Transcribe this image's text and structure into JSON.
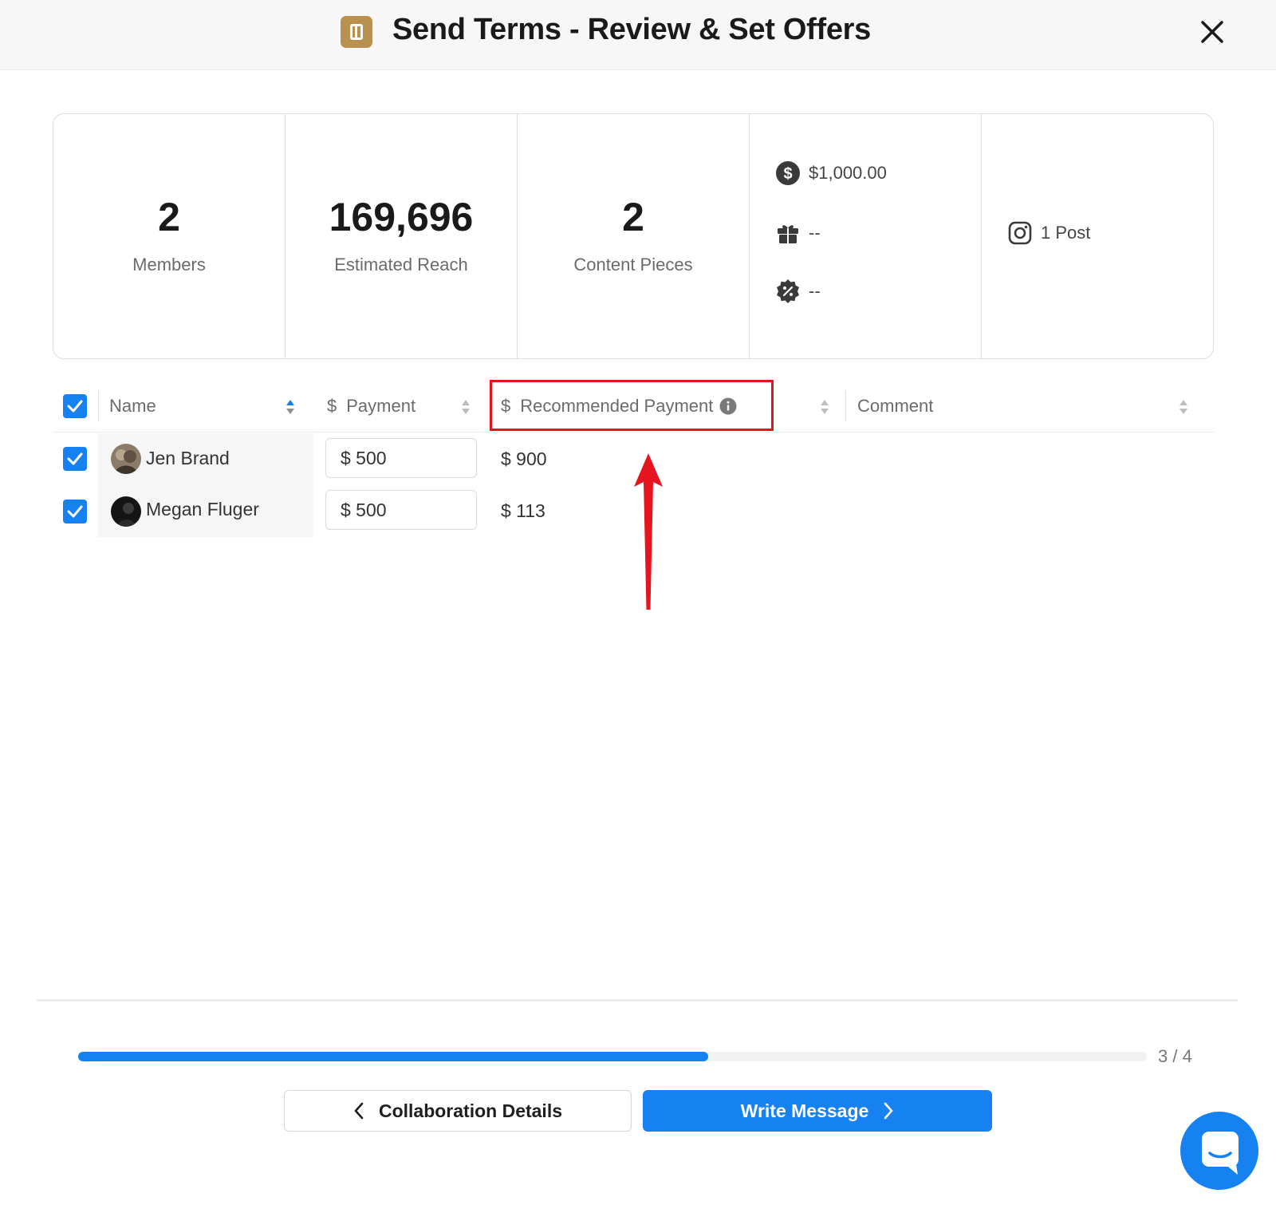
{
  "header": {
    "title": "Send Terms - Review & Set Offers",
    "app_icon": "document-icon",
    "close_icon": "close-icon"
  },
  "stats": [
    {
      "value": "2",
      "label": "Members"
    },
    {
      "value": "169,696",
      "label": "Estimated Reach"
    },
    {
      "value": "2",
      "label": "Content Pieces"
    }
  ],
  "terms": {
    "payment": {
      "icon": "dollar-circle-icon",
      "value": "$1,000.00"
    },
    "product": {
      "icon": "gift-icon",
      "value": "--"
    },
    "discount": {
      "icon": "percent-badge-icon",
      "value": "--"
    }
  },
  "deliverables": {
    "icon": "instagram-icon",
    "text": "1 Post"
  },
  "table": {
    "headers": {
      "name": "Name",
      "payment_symbol": "$",
      "payment": "Payment",
      "recommended_symbol": "$",
      "recommended": "Recommended Payment",
      "comment": "Comment"
    },
    "rows": [
      {
        "name": "Jen Brand",
        "payment_value": "$ 500",
        "recommended": "$ 900"
      },
      {
        "name": "Megan Fluger",
        "payment_value": "$ 500",
        "recommended": "$ 113"
      }
    ]
  },
  "progress": {
    "text": "3 / 4",
    "fraction": 0.5897
  },
  "buttons": {
    "back": "Collaboration Details",
    "next": "Write Message"
  },
  "colors": {
    "accent": "#1682f2",
    "app_icon": "#b9914f",
    "annotation": "#e5141f"
  }
}
